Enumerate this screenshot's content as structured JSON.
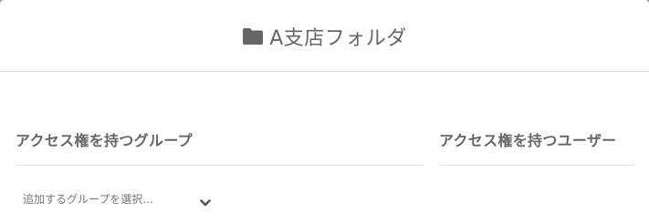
{
  "modal": {
    "title": "A支店フォルダ",
    "title_icon": "folder-icon"
  },
  "groups_section": {
    "title": "アクセス権を持つグループ",
    "select": {
      "placeholder": "追加するグループを選択...",
      "icon": "chevron-down-icon"
    }
  },
  "users_section": {
    "title": "アクセス権を持つユーザー"
  },
  "colors": {
    "text": "#666666",
    "divider": "#d6d6d6",
    "background": "#ffffff"
  }
}
